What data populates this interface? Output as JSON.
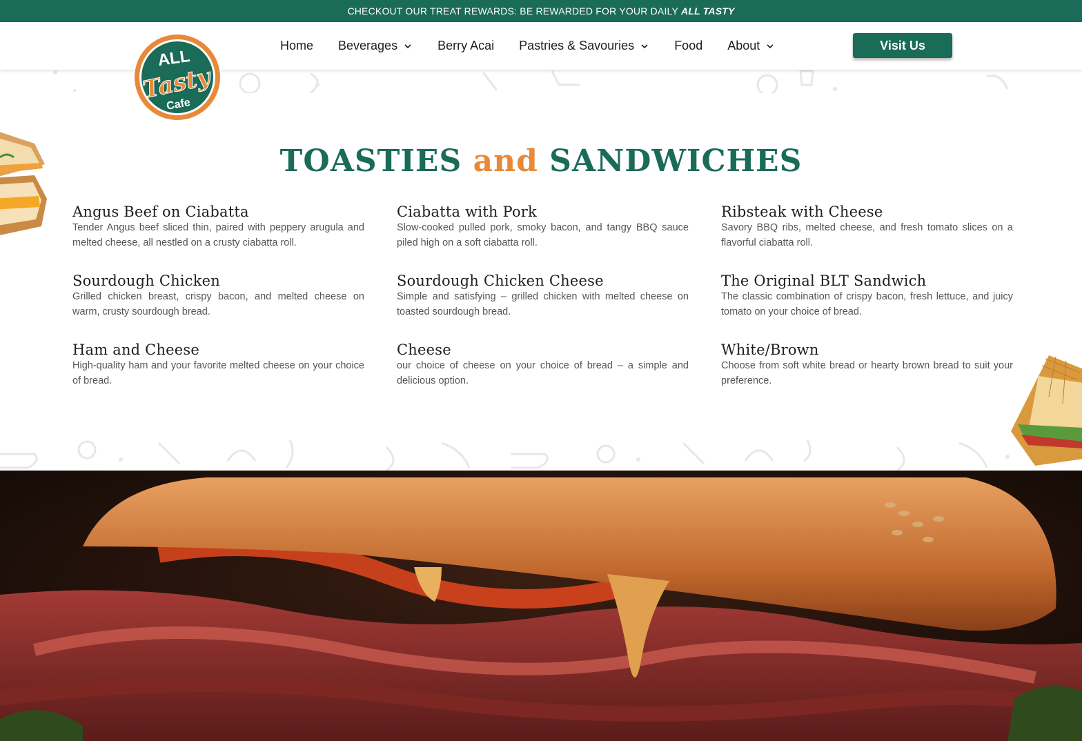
{
  "topbar": {
    "text": "CHECKOUT OUR TREAT REWARDS: BE REWARDED FOR YOUR DAILY",
    "emphasis": "ALL TASTY"
  },
  "logo": {
    "line1": "ALL",
    "line2": "Tasty",
    "line3": "Cafe"
  },
  "nav": {
    "items": [
      {
        "label": "Home",
        "has_dropdown": false
      },
      {
        "label": "Beverages",
        "has_dropdown": true
      },
      {
        "label": "Berry Acai",
        "has_dropdown": false
      },
      {
        "label": "Pastries & Savouries",
        "has_dropdown": true
      },
      {
        "label": "Food",
        "has_dropdown": false
      },
      {
        "label": "About",
        "has_dropdown": true
      }
    ],
    "cta": "Visit Us"
  },
  "section": {
    "title_part1": "TOASTIES",
    "title_and": "and",
    "title_part2": "SANDWICHES"
  },
  "menu": [
    {
      "name": "Angus Beef on Ciabatta",
      "desc": "Tender Angus beef sliced thin, paired with peppery arugula and melted cheese, all nestled on a crusty ciabatta roll."
    },
    {
      "name": "Ciabatta with Pork",
      "desc": "Slow-cooked pulled pork, smoky bacon, and tangy BBQ sauce piled high on a soft ciabatta roll."
    },
    {
      "name": "Ribsteak with Cheese",
      "desc": "Savory BBQ ribs, melted cheese, and fresh tomato slices on a flavorful ciabatta roll."
    },
    {
      "name": "Sourdough Chicken",
      "desc": "Grilled chicken breast, crispy bacon, and melted cheese on warm, crusty sourdough bread."
    },
    {
      "name": "Sourdough Chicken Cheese",
      "desc": "Simple and satisfying – grilled chicken with melted cheese on toasted sourdough bread."
    },
    {
      "name": "The Original BLT Sandwich",
      "desc": "The classic combination of crispy bacon, fresh lettuce, and juicy tomato on your choice of bread."
    },
    {
      "name": "Ham and Cheese",
      "desc": "High-quality ham and your favorite melted cheese on your choice of bread."
    },
    {
      "name": "Cheese",
      "desc": "our choice of cheese on your choice of bread – a simple and delicious option."
    },
    {
      "name": "White/Brown",
      "desc": "Choose from soft white bread or hearty brown bread to suit your preference."
    }
  ],
  "colors": {
    "brand_green": "#1a6b58",
    "accent_orange": "#e8893a"
  },
  "icons": [
    "chevron-down-icon",
    "logo"
  ]
}
